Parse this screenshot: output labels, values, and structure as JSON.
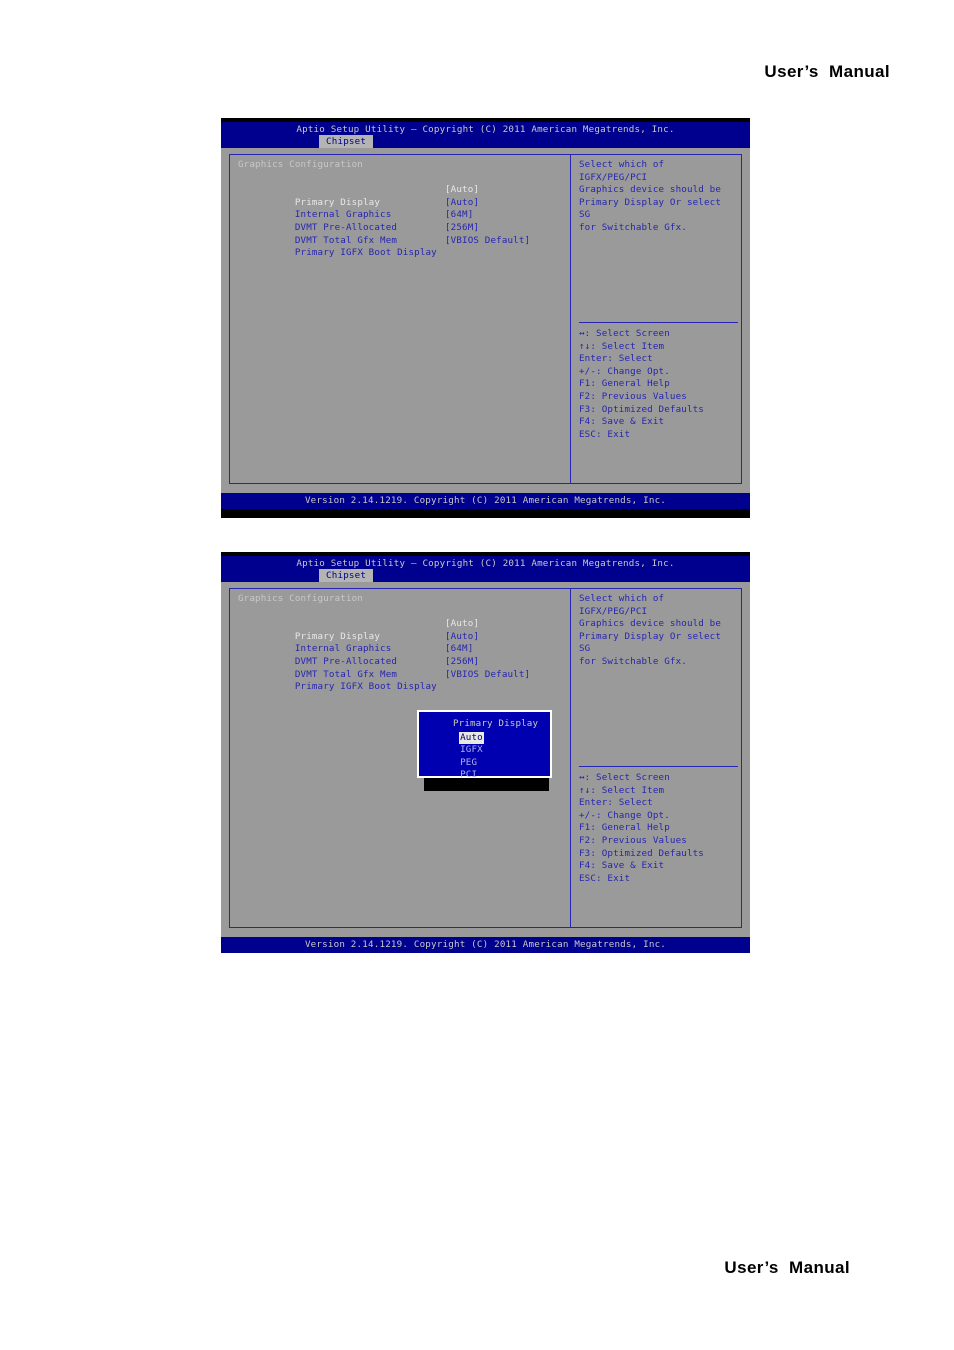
{
  "page": {
    "header_title": "User’s  Manual",
    "footer_title": "User’s  Manual"
  },
  "colors": {
    "title_bar": "#00008f",
    "panel_bg": "#9a9a9a",
    "accent_blue": "#2626b0",
    "highlight_text": "#e8e8e8",
    "popup_bg": "#0000b0"
  },
  "bios": {
    "title": "Aptio Setup Utility – Copyright (C) 2011 American Megatrends, Inc.",
    "tab": "Chipset",
    "footer": "Version 2.14.1219. Copyright (C) 2011 American Megatrends, Inc.",
    "section_title": "Graphics Configuration",
    "options": [
      {
        "label": "Primary Display",
        "value": "[Auto]",
        "selected": true
      },
      {
        "label": "Internal Graphics",
        "value": "[Auto]",
        "selected": false
      },
      {
        "label": "DVMT Pre-Allocated",
        "value": "[64M]",
        "selected": false
      },
      {
        "label": "DVMT Total Gfx Mem",
        "value": "[256M]",
        "selected": false
      },
      {
        "label": "Primary IGFX Boot Display",
        "value": "[VBIOS Default]",
        "selected": false
      }
    ],
    "help_text": "Select which of IGFX/PEG/PCI\nGraphics device should be\nPrimary Display Or select SG\nfor Switchable Gfx.",
    "legend": [
      "↔: Select Screen",
      "↑↓: Select Item",
      "Enter: Select",
      "+/-: Change Opt.",
      "F1: General Help",
      "F2: Previous Values",
      "F3: Optimized Defaults",
      "F4: Save & Exit",
      "ESC: Exit"
    ]
  },
  "popup": {
    "title": "Primary Display",
    "items": [
      {
        "label": "Auto",
        "active": true
      },
      {
        "label": "IGFX",
        "active": false
      },
      {
        "label": "PEG",
        "active": false
      },
      {
        "label": "PCI",
        "active": false
      }
    ]
  }
}
